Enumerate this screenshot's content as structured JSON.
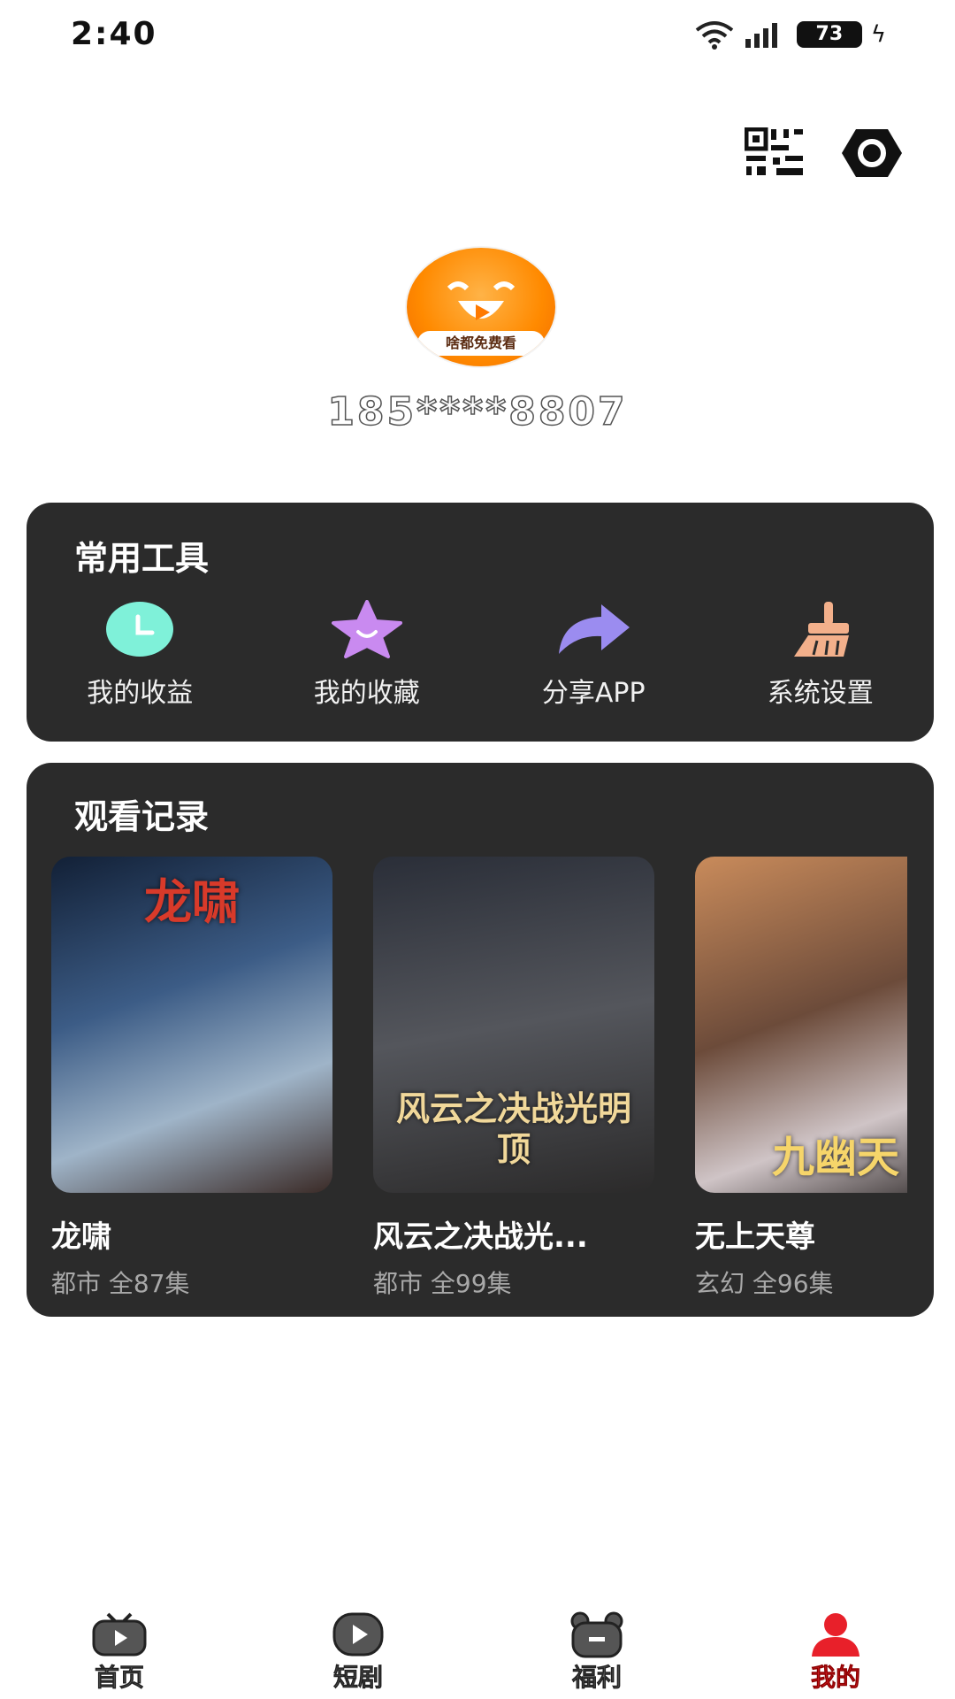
{
  "status_bar": {
    "time": "2:40",
    "battery": "73"
  },
  "profile": {
    "avatar_text": "啥都免费看",
    "phone": "185****8807"
  },
  "tools": {
    "title": "常用工具",
    "items": [
      {
        "label": "我的收益",
        "icon": "clock-icon",
        "color": "#7ff1d9"
      },
      {
        "label": "我的收藏",
        "icon": "star-icon",
        "color": "#c98af0"
      },
      {
        "label": "分享APP",
        "icon": "share-arrow-icon",
        "color": "#9b8cf0"
      },
      {
        "label": "系统设置",
        "icon": "broom-icon",
        "color": "#f3b08b"
      }
    ]
  },
  "history": {
    "title": "观看记录",
    "items": [
      {
        "title": "龙啸",
        "genre": "都市",
        "episodes": "全87集",
        "meta": "都市 全87集",
        "poster_text": "龙啸"
      },
      {
        "title": "风云之决战光...",
        "genre": "都市",
        "episodes": "全99集",
        "meta": "都市 全99集",
        "poster_text": "风云之决战光明顶"
      },
      {
        "title": "无上天尊",
        "genre": "玄幻",
        "episodes": "全96集",
        "meta": "玄幻 全96集",
        "poster_text": "九幽天"
      }
    ]
  },
  "bottom_nav": {
    "items": [
      {
        "label": "首页",
        "icon": "tv-play-icon",
        "active": false
      },
      {
        "label": "短剧",
        "icon": "play-circle-icon",
        "active": false
      },
      {
        "label": "福利",
        "icon": "gift-face-icon",
        "active": false
      },
      {
        "label": "我的",
        "icon": "user-icon",
        "active": true
      }
    ]
  },
  "colors": {
    "card_bg": "#2b2b2b",
    "active_nav": "#e8202a",
    "meta_text": "#a8a8a8"
  }
}
